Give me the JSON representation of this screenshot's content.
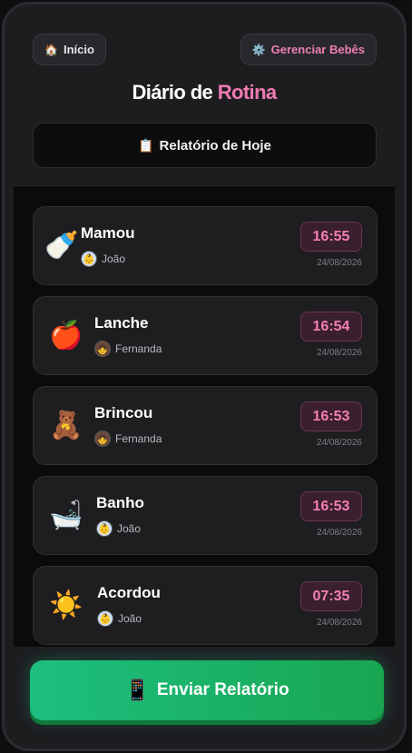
{
  "header": {
    "home_icon": "house-icon",
    "home_label": "Início",
    "manage_icon": "gear-icon",
    "manage_label": "Gerenciar Bebês",
    "title_main": "Diário de",
    "title_accent": "Rotina",
    "accent_color": "#f07ab2"
  },
  "report": {
    "icon": "clipboard-icon",
    "heading": "Relatório de Hoje"
  },
  "entries": [
    {
      "emoji": "🍼",
      "icon": "baby-bottle-icon",
      "label": "Mamou",
      "person": "João",
      "avatar_emoji": "👶",
      "time": "16:55",
      "date": "24/08/2026"
    },
    {
      "emoji": "🍎",
      "icon": "apple-icon",
      "label": "Lanche",
      "person": "Fernanda",
      "avatar_emoji": "👧",
      "time": "16:54",
      "date": "24/08/2026"
    },
    {
      "emoji": "🧸",
      "icon": "teddy-bear-icon",
      "label": "Brincou",
      "person": "Fernanda",
      "avatar_emoji": "👧",
      "time": "16:53",
      "date": "24/08/2026"
    },
    {
      "emoji": "🛁",
      "icon": "bathtub-icon",
      "label": "Banho",
      "person": "João",
      "avatar_emoji": "👶",
      "time": "16:53",
      "date": "24/08/2026"
    },
    {
      "emoji": "☀️",
      "icon": "sun-icon",
      "label": "Acordou",
      "person": "João",
      "avatar_emoji": "👶",
      "time": "07:35",
      "date": "24/08/2026"
    }
  ],
  "send": {
    "icon": "mobile-phone-icon",
    "label": "Enviar Relatório",
    "color": "#1dbf80"
  }
}
